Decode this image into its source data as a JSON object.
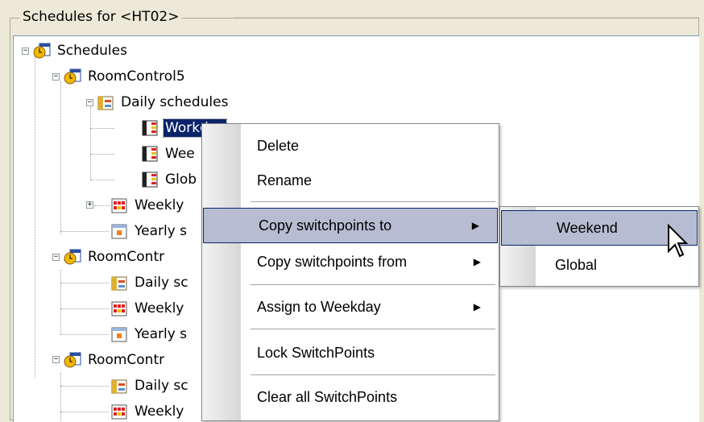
{
  "group": {
    "label": "Schedules for  <HT02>"
  },
  "tree": {
    "root": "Schedules",
    "items": [
      {
        "label": "RoomControl5"
      },
      {
        "label": "Daily schedules"
      },
      {
        "label": "Workday"
      },
      {
        "label": "Wee"
      },
      {
        "label": "Glob"
      },
      {
        "label": "Weekly"
      },
      {
        "label": "Yearly s"
      },
      {
        "label": "RoomContr"
      },
      {
        "label": "Daily sc"
      },
      {
        "label": "Weekly"
      },
      {
        "label": "Yearly s"
      },
      {
        "label": "RoomContr"
      },
      {
        "label": "Daily sc"
      },
      {
        "label": "Weekly"
      }
    ]
  },
  "context_menu": {
    "items": [
      {
        "label": "Delete"
      },
      {
        "label": "Rename"
      },
      {
        "label": "Copy switchpoints to",
        "submenu": true,
        "highlighted": true
      },
      {
        "label": "Copy switchpoints from",
        "submenu": true
      },
      {
        "label": "Assign to Weekday",
        "submenu": true
      },
      {
        "label": "Lock SwitchPoints"
      },
      {
        "label": "Clear all SwitchPoints"
      }
    ]
  },
  "submenu": {
    "items": [
      {
        "label": "Weekend",
        "highlighted": true
      },
      {
        "label": "Global"
      }
    ]
  },
  "colors": {
    "selection": "#0a246a",
    "menu_highlight": "#b6bdd2"
  },
  "icons": [
    "clock-schedule-icon",
    "daily-schedule-icon",
    "switchpoint-list-icon",
    "weekly-schedule-icon",
    "yearly-schedule-icon",
    "submenu-arrow-icon",
    "mouse-pointer-icon"
  ]
}
